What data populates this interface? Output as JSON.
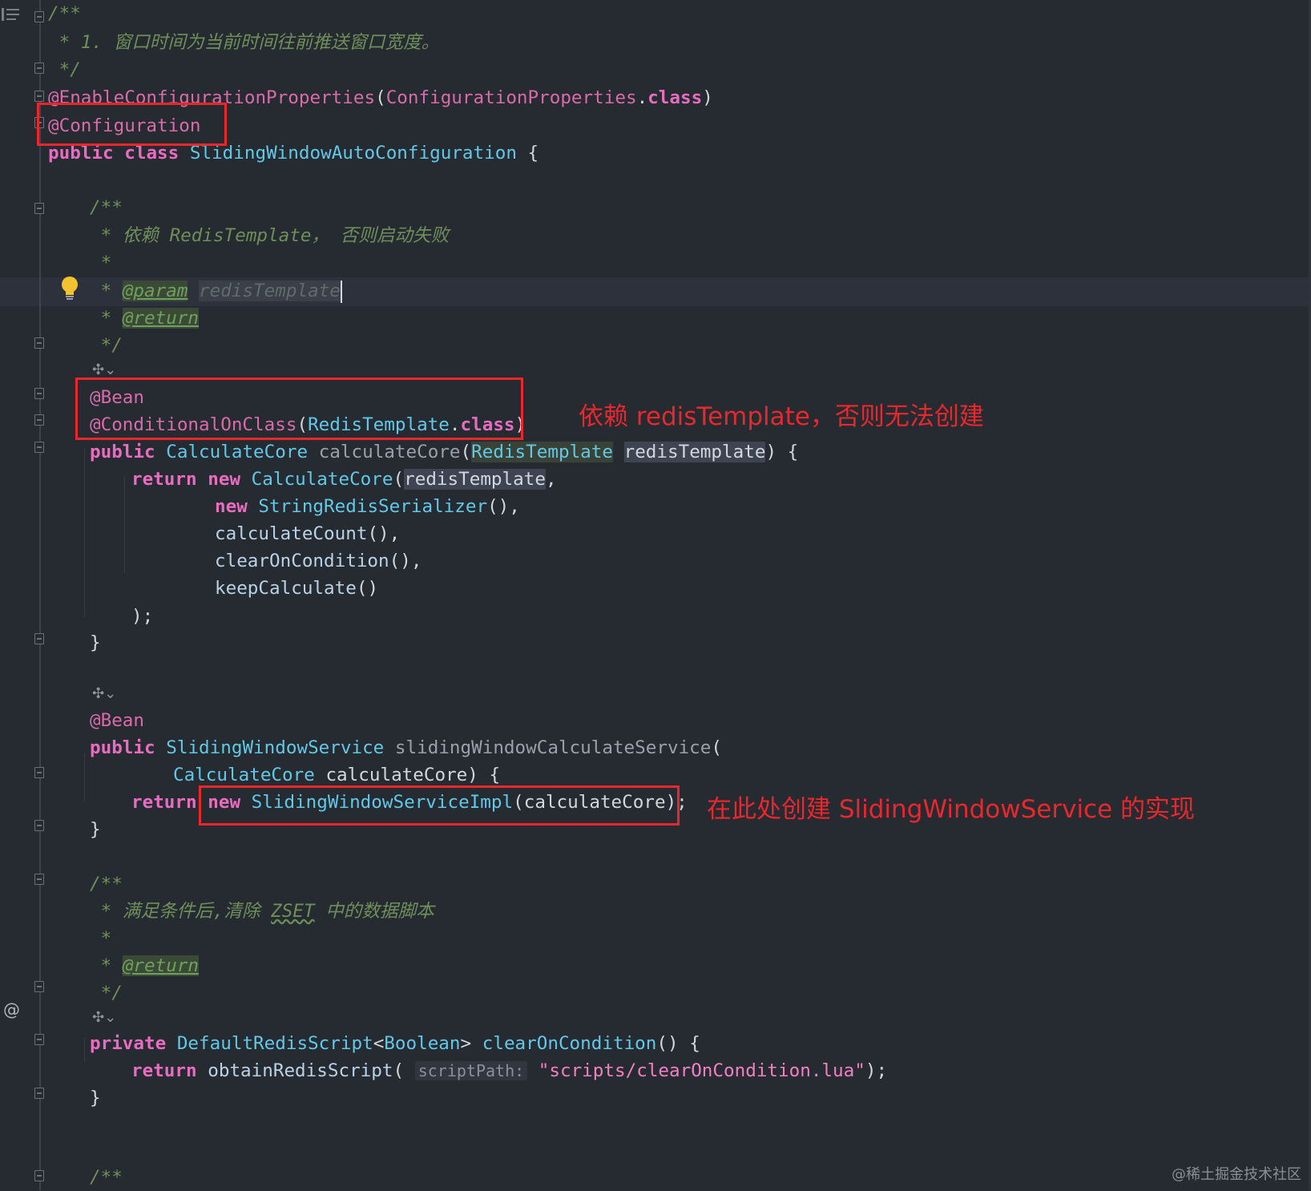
{
  "editor": {
    "comment1_open": "/**",
    "comment1_body": " * 1. 窗口时间为当前时间往前推送窗口宽度。",
    "comment1_close": " */",
    "enable_ann": "@EnableConfigurationProperties",
    "enable_paren_open": "(",
    "enable_arg": "ConfigurationProperties",
    "dot": ".",
    "class_kw": "class",
    "paren_close": ")",
    "config_ann": "@Configuration",
    "public_kw": "public",
    "class_kw2": "class",
    "class_name": "SlidingWindowAutoConfiguration",
    "brace_open": " {",
    "doc1_open": "/**",
    "doc1_body": " * 依赖 RedisTemplate， 否则启动失败",
    "doc1_star": " *",
    "doc1_star_prefix": " * ",
    "param_tag": "@param",
    "param_name": "redisTemplate",
    "return_tag": "@return",
    "doc1_close": " */",
    "bean_ann": "@Bean",
    "cond_ann": "@ConditionalOnClass",
    "redis_template_type": "RedisTemplate",
    "calc_core_type": "CalculateCore",
    "calc_core_method": "calculateCore",
    "redis_param": "redisTemplate",
    "close_brace_open": ") {",
    "return_kw": "return",
    "new_kw": "new",
    "calc_core_ctor": "CalculateCore",
    "comma": ",",
    "string_serializer": "StringRedisSerializer",
    "empty_call_comma": "(),",
    "calculate_count": "calculateCount",
    "clear_on_condition": "clearOnCondition",
    "keep_calculate": "keepCalculate",
    "empty_call": "()",
    "close_stmt": ");",
    "close_brace": "}",
    "sliding_service_type": "SlidingWindowService",
    "sliding_service_method": "slidingWindowCalculateService",
    "calc_core_param": "calculateCore",
    "sliding_impl": "SlidingWindowServiceImpl",
    "calc_core_arg": "calculateCore",
    "doc2_open": "/**",
    "doc2_body_a": " * 满足条件后,清除 ",
    "doc2_zset": "ZSET",
    "doc2_body_b": " 中的数据脚本",
    "doc2_star": " *",
    "doc2_close": " */",
    "private_kw": "private",
    "default_script": "DefaultRedisScript",
    "lt": "<",
    "boolean_type": "Boolean",
    "gt": ">",
    "clear_decl": "clearOnCondition",
    "obtain_script": "obtainRedisScript",
    "hint_script_path": "scriptPath:",
    "script_string": "\"scripts/clearOnCondition.lua\"",
    "doc3_open": "/**"
  },
  "annotations": {
    "note1": "依赖 redisTemplate，否则无法创建",
    "note2": "在此处创建 SlidingWindowService 的实现"
  },
  "watermark": "@稀土掘金技术社区",
  "icons": {
    "bulb": "lightbulb-icon",
    "bean": "spring-bean-icon",
    "override": "at-sign-icon",
    "structure": "structure-icon"
  },
  "colors": {
    "background": "#262a31",
    "keyword": "#e86cc0",
    "type": "#62c8e8",
    "comment": "#6e8f5a",
    "annotation_box": "#e8282c"
  }
}
